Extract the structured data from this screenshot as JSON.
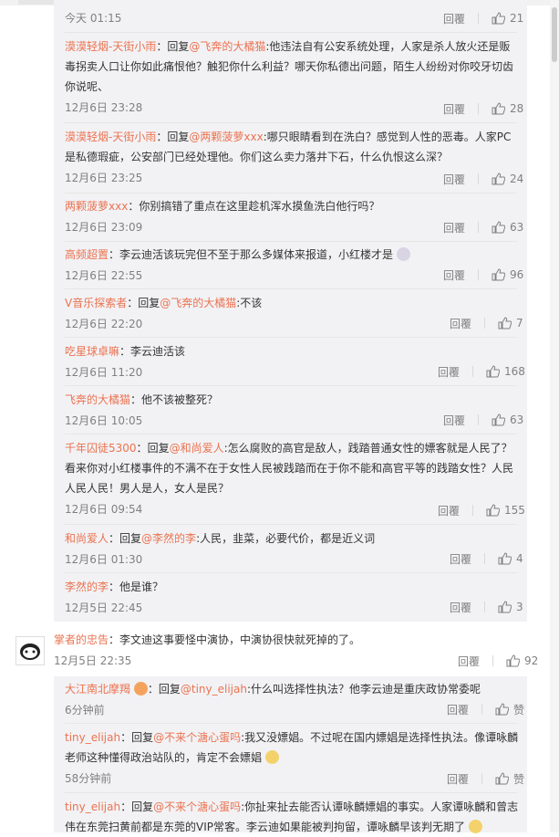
{
  "labels": {
    "reply": "回覆"
  },
  "colors": {
    "name": "#eb7350",
    "panel": "#f2f2f5",
    "meta": "#808080"
  },
  "replies": [
    {
      "time": "今天 01:15",
      "likes": "21"
    },
    {
      "name": "漠漠轻烟-天街小雨",
      "colon": "：",
      "pre": "回复",
      "at": "@飞奔的大橘猫",
      "text1": ":他违法自有公安系统处理，人家是杀人放火还是贩",
      "text2": "毒拐卖人口让你如此痛恨他？触犯你什么利益？哪天你私德出问题，陌生人纷纷对你咬牙切齿",
      "text3": "你说呢、",
      "time": "12月6日 23:28",
      "likes": "28"
    },
    {
      "name": "漠漠轻烟-天街小雨",
      "colon": "：",
      "pre": "回复",
      "at": "@两颗菠萝xxx",
      "text1": ":哪只眼睛看到在洗白？感觉到人性的恶毒。人家PC",
      "text2": "是私德瑕疵，公安部门已经处理他。你们这么卖力落井下石，什么仇恨这么深？",
      "time": "12月6日 23:25",
      "likes": "24"
    },
    {
      "name": "两颗菠萝xxx",
      "colon": "：",
      "text1": "你别搞错了重点在这里趁机浑水摸鱼洗白他行吗？",
      "time": "12月6日 23:09",
      "likes": "63"
    },
    {
      "name": "高频超置",
      "colon": "：",
      "text1": "李云迪活该玩完但不至于那么多媒体来报道，小红楼才是",
      "time": "12月6日 22:55",
      "likes": "96"
    },
    {
      "name": "V音乐探索者",
      "colon": "：",
      "pre": "回复",
      "at": "@飞奔的大橘猫",
      "text1": ":不该",
      "time": "12月6日 22:20",
      "likes": "7"
    },
    {
      "name": "吃星球卓嘛",
      "colon": "：",
      "text1": "李云迪活该",
      "time": "12月6日 11:20",
      "likes": "168"
    },
    {
      "name": "飞奔的大橘猫",
      "colon": "：",
      "text1": "他不该被整死？",
      "time": "12月6日 10:05",
      "likes": "63"
    },
    {
      "name": "千年囚徒5300",
      "colon": "：",
      "pre": "回复",
      "at": "@和尚爱人",
      "text1": ":怎么腐败的高官是敌人，践踏普通女性的嫖客就是人民了？",
      "text2": "看来你对小红楼事件的不满不在于女性人民被践踏而在于你不能和高官平等的践踏女性？人民",
      "text3": "人民人民！男人是人，女人是民？",
      "time": "12月6日 09:54",
      "likes": "155"
    },
    {
      "name": "和尚爱人",
      "colon": "：",
      "pre": "回复",
      "at": "@李然的李",
      "text1": ":人民，韭菜，必要代价，都是近义词",
      "time": "12月6日 01:30",
      "likes": "4"
    },
    {
      "name": "李然的李",
      "colon": "：",
      "text1": "他是谁？",
      "time": "12月5日 22:45",
      "likes": "3"
    }
  ],
  "comment": {
    "name": "掌者的忠告",
    "colon": "：",
    "text": "李文迪这事要怪中演协，中演协很快就死掉的了。",
    "time": "12月5日 22:35",
    "likes": "92"
  },
  "replies2": [
    {
      "name": "大江南北摩羯",
      "colon": "：",
      "pre": "回复",
      "at": "@tiny_elijah",
      "text1": ":什么叫选择性执法？他李云迪是重庆政协常委呢",
      "time": "6分钟前",
      "likes": "赞"
    },
    {
      "name": "tiny_elijah",
      "colon": "：",
      "pre": "回复",
      "at": "@不来个溏心蛋吗",
      "text1": ":我又没嫖娼。不过呢在国内嫖娼是选择性执法。像谭咏麟",
      "text2": "老师这种懂得政治站队的，肯定不会嫖娼",
      "time": "58分钟前",
      "likes": "赞"
    },
    {
      "name": "tiny_elijah",
      "colon": "：",
      "pre": "回复",
      "at": "@不来个溏心蛋吗",
      "text1": ":你扯来扯去能否认谭咏麟嫖娼的事实。人家谭咏麟和曾志",
      "text2": "伟在东莞扫黄前都是东莞的VIP常客。李云迪如果能被判拘留，谭咏麟早该判无期了"
    }
  ]
}
